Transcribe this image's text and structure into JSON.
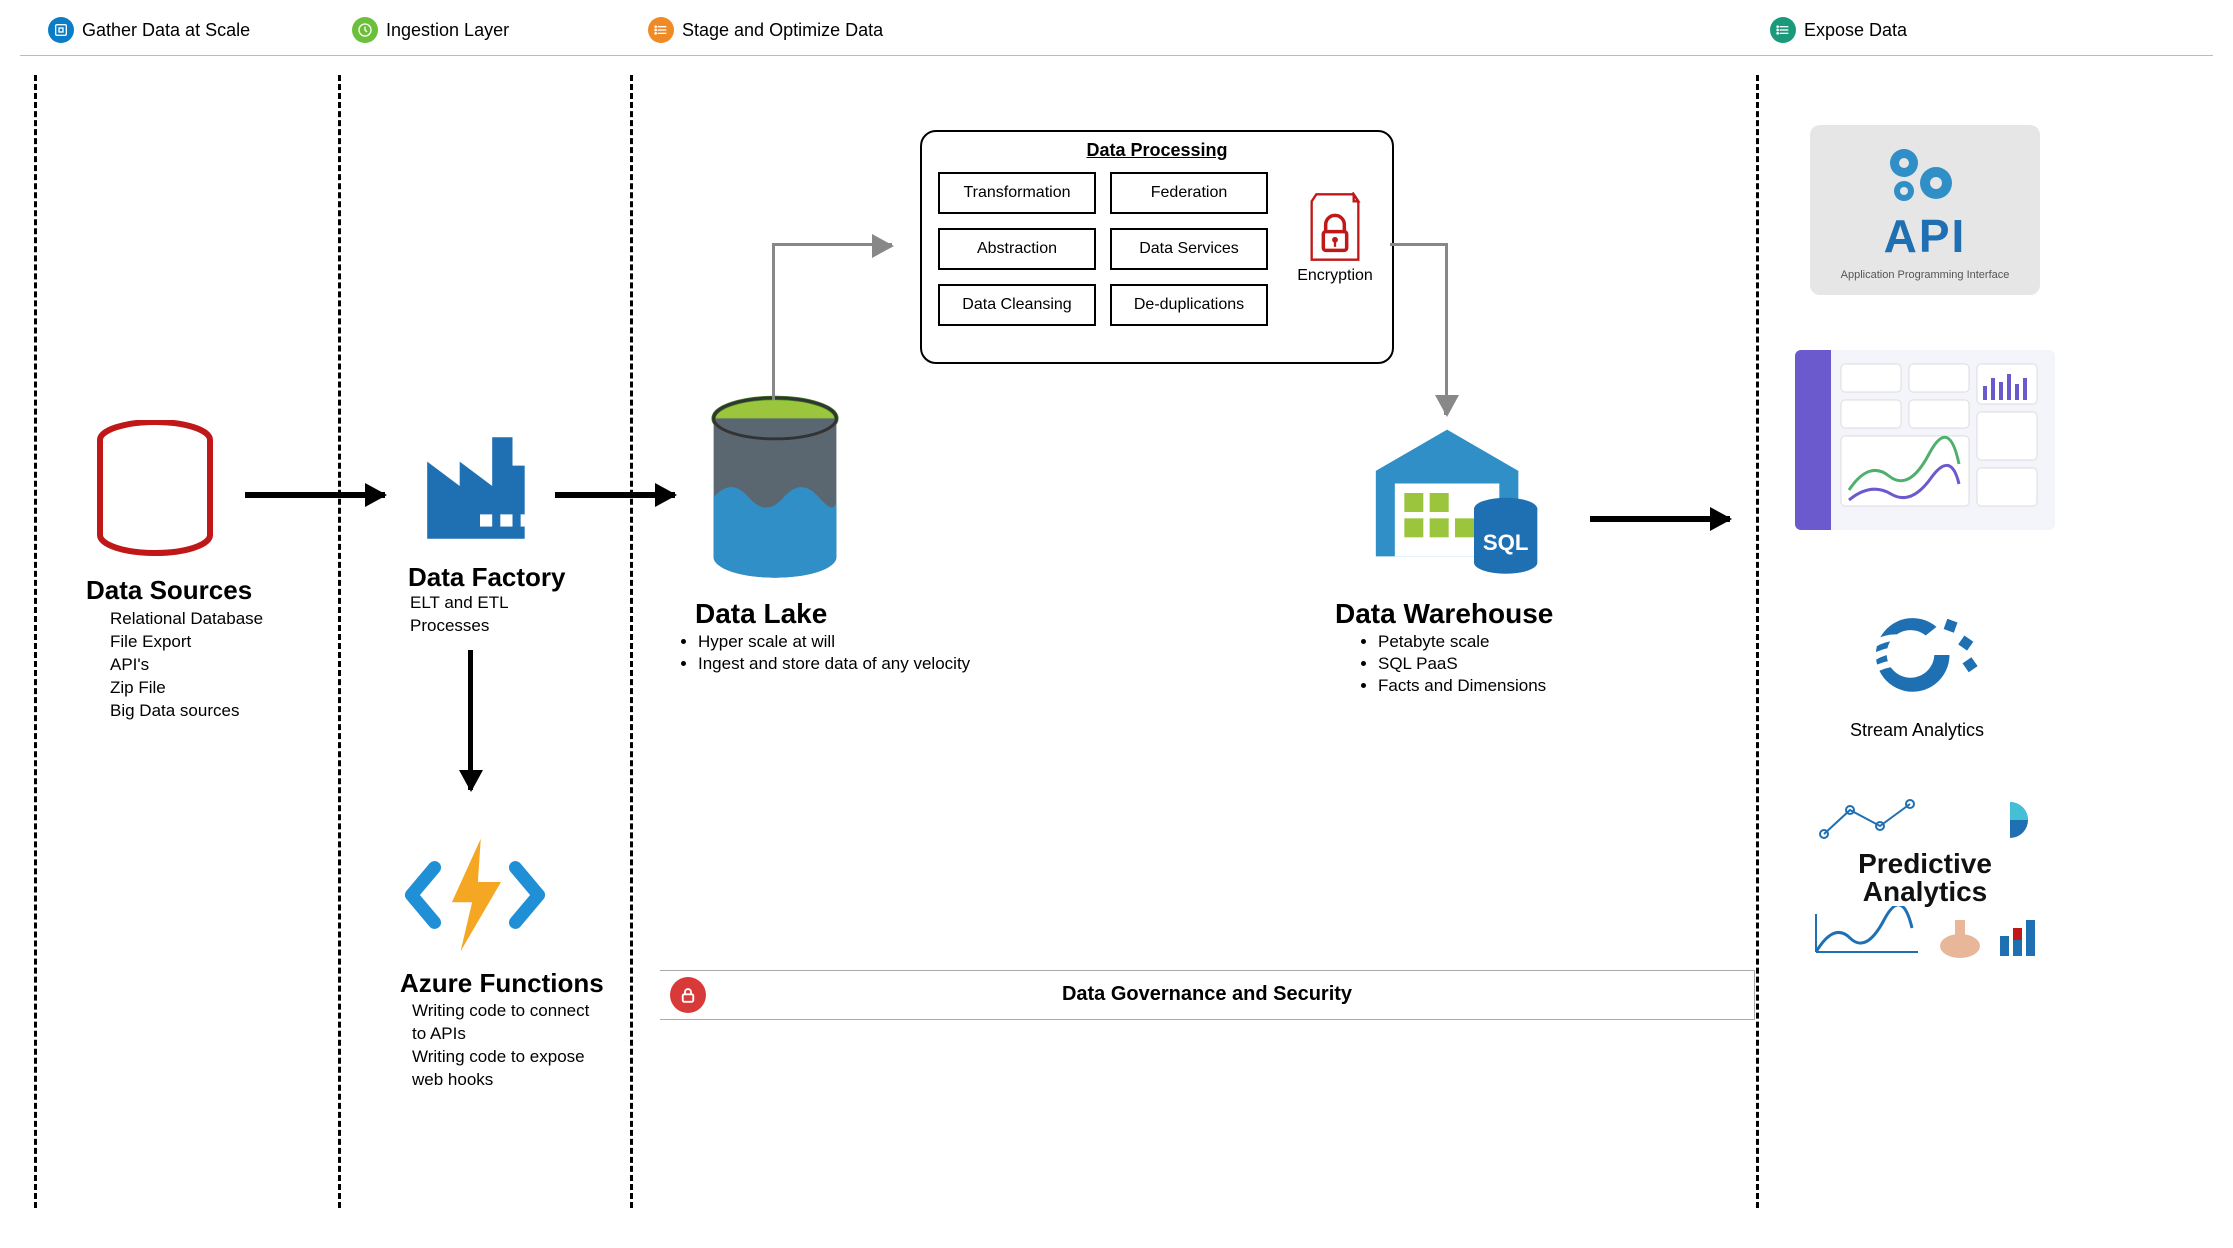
{
  "lanes": {
    "gather": "Gather Data at Scale",
    "ingest": "Ingestion Layer",
    "stage": "Stage and Optimize Data",
    "expose": "Expose Data"
  },
  "dataSources": {
    "title": "Data Sources",
    "items": [
      "Relational Database",
      "File Export",
      "API's",
      "Zip File",
      "Big Data sources"
    ]
  },
  "dataFactory": {
    "title": "Data Factory",
    "subtitle": "ELT and ETL Processes"
  },
  "azureFunctions": {
    "title": "Azure Functions",
    "line1": "Writing code to connect to APIs",
    "line2": "Writing code to expose web hooks"
  },
  "dataLake": {
    "title": "Data Lake",
    "bullets": [
      "Hyper scale at will",
      "Ingest and store data of any velocity"
    ]
  },
  "dataProcessing": {
    "title": "Data Processing",
    "cells": [
      "Transformation",
      "Federation",
      "Abstraction",
      "Data Services",
      "Data Cleansing",
      "De-duplications"
    ],
    "encryption": "Encryption"
  },
  "dataWarehouse": {
    "title": "Data Warehouse",
    "bullets": [
      "Petabyte scale",
      "SQL PaaS",
      "Facts and Dimensions"
    ]
  },
  "governance": "Data Governance and Security",
  "expose": {
    "apiTitle": "API",
    "apiSub": "Application Programming Interface",
    "stream": "Stream Analytics",
    "predictive1": "Predictive",
    "predictive2": "Analytics"
  },
  "colors": {
    "azureBlue": "#1f6fb3",
    "red": "#c01818",
    "green": "#9bc53d"
  }
}
